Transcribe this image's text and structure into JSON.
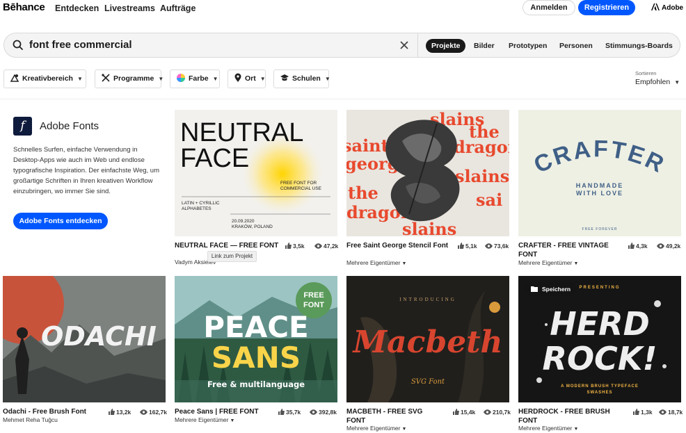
{
  "header": {
    "logo": "Bēhance",
    "nav": [
      "Entdecken",
      "Livestreams",
      "Aufträge"
    ],
    "login_label": "Anmelden",
    "register_label": "Registrieren",
    "adobe_label": "Adobe"
  },
  "search": {
    "value": "font free commercial",
    "tabs": [
      "Projekte",
      "Bilder",
      "Prototypen",
      "Personen",
      "Stimmungs-Boards"
    ],
    "active_tab": "Projekte"
  },
  "filters": [
    "Kreativbereich",
    "Programme",
    "Farbe",
    "Ort",
    "Schulen"
  ],
  "sort": {
    "label": "Sortieren",
    "value": "Empfohlen"
  },
  "promo": {
    "logo_glyph": "f",
    "title": "Adobe Fonts",
    "text": "Schnelles Surfen, einfache Verwendung in Desktop-Apps wie auch im Web und endlose typografische Inspiration. Der einfachste Weg, um großartige Schriften in Ihren kreativen Workflow einzubringen, wo immer Sie sind.",
    "button": "Adobe Fonts entdecken"
  },
  "tooltip": "Link zum Projekt",
  "save_label": "Speichern",
  "projects": [
    {
      "title": "NEUTRAL FACE — FREE FONT",
      "owner": "Vadym Aksielev",
      "likes": "3,5k",
      "views": "47,2k",
      "art": {
        "line1": "NEUTRAL",
        "line2": "FACE",
        "sub1": "FREE FONT FOR",
        "sub2": "COMMERCIAL USE",
        "sub3": "LATIN + CYRILLIC",
        "sub4": "ALPHABETES",
        "sub5": "20.09.2020",
        "sub6": "KRAKÓW, POLAND"
      }
    },
    {
      "title": "Free Saint George Stencil Font",
      "owner": "Mehrere Eigentümer",
      "likes": "5,1k",
      "views": "73,6k",
      "art": {
        "words": [
          "slains",
          "the",
          "saint",
          "dragon",
          "george",
          "slains",
          "the",
          "dragon",
          "sai",
          "slains"
        ]
      }
    },
    {
      "title": "CRAFTER - FREE VINTAGE FONT",
      "owner": "Mehrere Eigentümer",
      "likes": "4,3k",
      "views": "49,2k",
      "art": {
        "main": "CRAFTER",
        "sub": "HANDMADE",
        "sub2": "WITH LOVE",
        "foot": "FREE FOREVER"
      }
    },
    {
      "title": "Odachi - Free Brush Font",
      "owner": "Mehmet Reha Tuğcu",
      "likes": "13,2k",
      "views": "162,7k",
      "art": {
        "main": "ODACHI"
      }
    },
    {
      "title": "Peace Sans | FREE FONT",
      "owner": "Mehrere Eigentümer",
      "likes": "35,7k",
      "views": "392,8k",
      "art": {
        "line1": "PEACE",
        "line2": "SANS",
        "badge1": "FREE",
        "badge2": "FONT",
        "sub": "Free & multilanguage"
      }
    },
    {
      "title": "MACBETH - FREE SVG FONT",
      "owner": "Mehrere Eigentümer",
      "likes": "15,4k",
      "views": "210,7k",
      "art": {
        "top": "INTRODUCING",
        "main": "Macbeth",
        "sub": "SVG Font"
      }
    },
    {
      "title": "HERDROCK - FREE BRUSH FONT",
      "owner": "Mehrere Eigentümer",
      "likes": "1,3k",
      "views": "18,7k",
      "art": {
        "top": "PRESENTING",
        "line1": "HERD",
        "line2": "ROCK!",
        "sub": "A MODERN BRUSH TYPEFACE",
        "sub2": "SWASHES"
      }
    }
  ],
  "colors": {
    "accent": "#0057ff",
    "promo_logo": "#0f1b3c"
  }
}
